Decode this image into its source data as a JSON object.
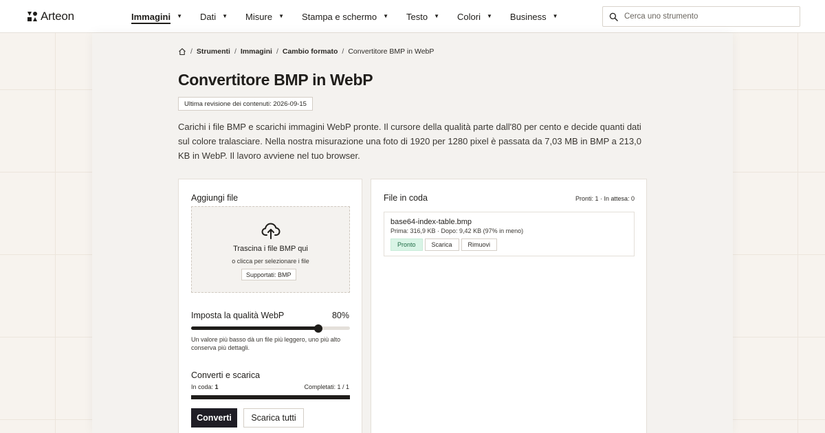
{
  "app": {
    "logo_text": "Arteon"
  },
  "nav": {
    "items": [
      {
        "label": "Immagini",
        "active": true
      },
      {
        "label": "Dati"
      },
      {
        "label": "Misure"
      },
      {
        "label": "Stampa e schermo"
      },
      {
        "label": "Testo"
      },
      {
        "label": "Colori"
      },
      {
        "label": "Business"
      }
    ],
    "caret": "▼"
  },
  "search": {
    "placeholder": "Cerca uno strumento",
    "icon": "search-icon"
  },
  "breadcrumb": {
    "home_icon": "home-icon",
    "separator": "/",
    "items": [
      "Strumenti",
      "Immagini",
      "Cambio formato"
    ],
    "current": "Convertitore BMP in WebP"
  },
  "page": {
    "title": "Convertitore BMP in WebP",
    "revision": "Ultima revisione dei contenuti: 2026-09-15",
    "intro": "Carichi i file BMP e scarichi immagini WebP pronte. Il cursore della qualità parte dall'80 per cento e decide quanti dati sul colore tralasciare. Nella nostra misurazione una foto di 1920 per 1280 pixel è passata da 7,03 MB in BMP a 213,0 KB in WebP. Il lavoro avviene nel tuo browser."
  },
  "upload": {
    "heading": "Aggiungi file",
    "icon": "upload-cloud-icon",
    "drop_title": "Trascina i file BMP qui",
    "drop_subtitle": "o clicca per selezionare i file",
    "supported": "Supportati: BMP"
  },
  "quality": {
    "label": "Imposta la qualità WebP",
    "value_text": "80%",
    "value": 80,
    "help": "Un valore più basso dà un file più leggero, uno più alto conserva più dettagli."
  },
  "convert": {
    "heading": "Converti e scarica",
    "queue_label": "In coda:",
    "queue_count": "1",
    "completed": "Completati: 1 / 1",
    "progress": 1.0,
    "convert_label": "Converti",
    "download_all_label": "Scarica tutti"
  },
  "queue": {
    "heading": "File in coda",
    "summary": "Pronti: 1 · In attesa: 0",
    "files": [
      {
        "name": "base64-index-table.bmp",
        "meta": "Prima: 316,9 KB · Dopo: 9,42 KB (97% in meno)",
        "status": "Pronto",
        "download_label": "Scarica",
        "remove_label": "Rimuovi"
      }
    ]
  },
  "colors": {
    "accent_dark": "#1f1d25",
    "status_ready_bg": "#d9f4e6"
  }
}
